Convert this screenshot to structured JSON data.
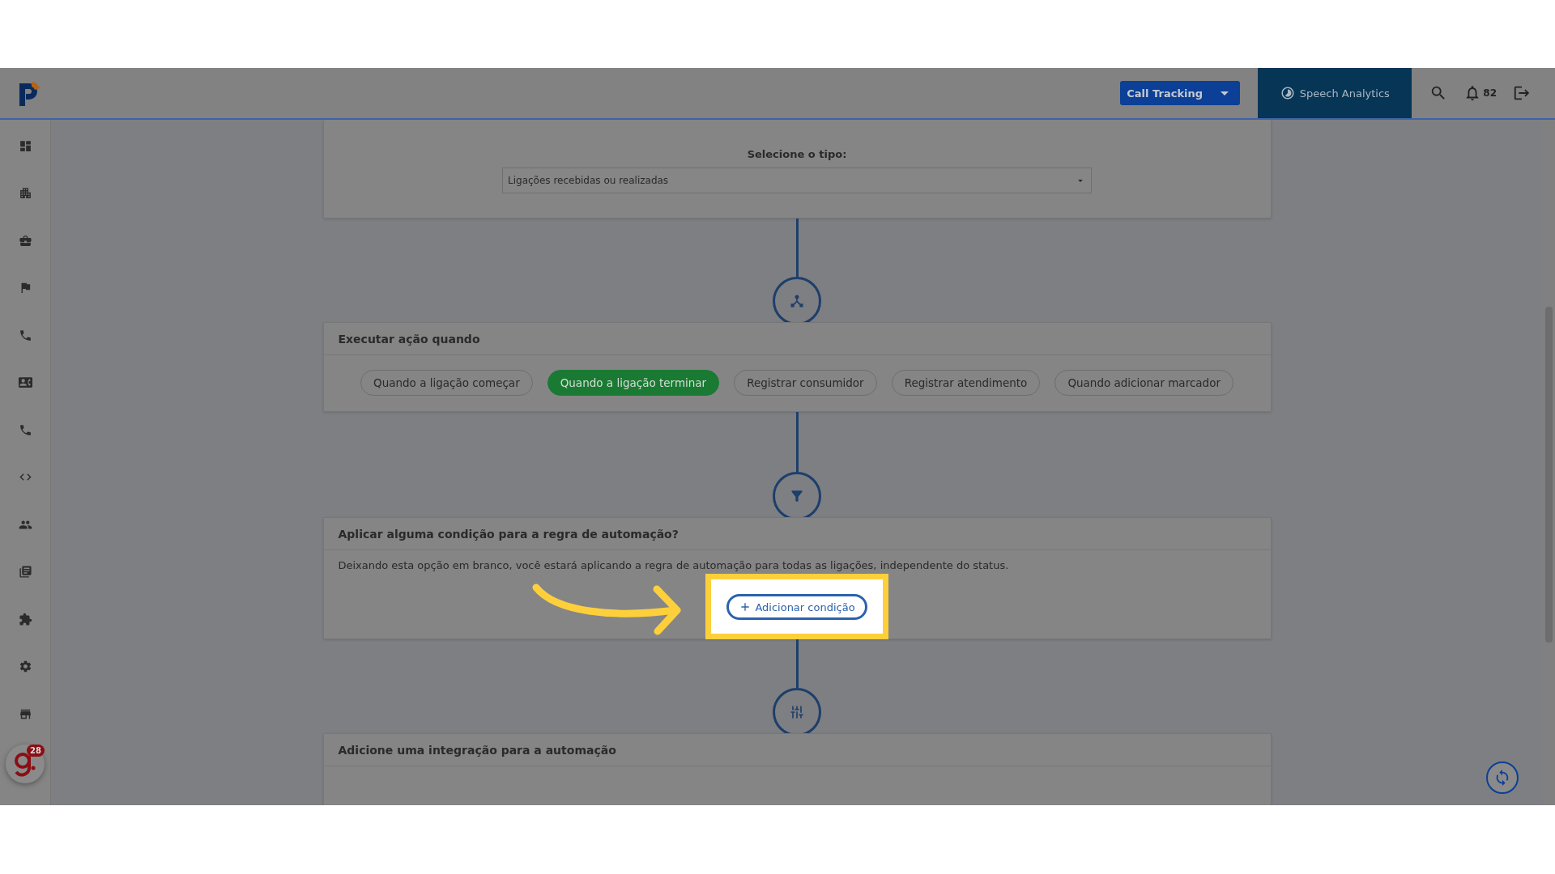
{
  "topbar": {
    "product_select": {
      "value": "Call Tracking"
    },
    "speech_analytics": {
      "label": "Speech Analytics",
      "selected": true
    },
    "notifications": {
      "count": "82"
    }
  },
  "assistant": {
    "badge": "28"
  },
  "type_card": {
    "label": "Selecione o tipo:",
    "select": {
      "value": "Ligações recebidas ou realizadas"
    }
  },
  "trigger_card": {
    "title": "Executar ação quando",
    "options": [
      {
        "label": "Quando a ligação começar",
        "selected": false
      },
      {
        "label": "Quando a ligação terminar",
        "selected": true
      },
      {
        "label": "Registrar consumidor",
        "selected": false
      },
      {
        "label": "Registrar atendimento",
        "selected": false
      },
      {
        "label": "Quando adicionar marcador",
        "selected": false
      }
    ]
  },
  "condition_card": {
    "title": "Aplicar alguma condição para a regra de automação?",
    "description": "Deixando esta opção em branco, você estará aplicando a regra de automação para todas as ligações, independente do status.",
    "button": {
      "label": "Adicionar condição",
      "highlighted": true
    }
  },
  "integration_card": {
    "title": "Adicione uma integração para a automação"
  }
}
